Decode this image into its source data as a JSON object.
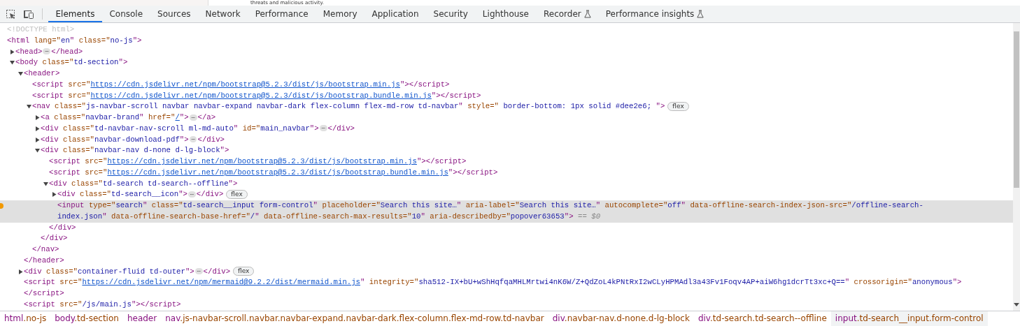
{
  "page_behind": {
    "text": "threats and malicious activity."
  },
  "toolbar": {
    "tabs": [
      {
        "label": "Elements",
        "selected": true,
        "experimental": false
      },
      {
        "label": "Console",
        "selected": false,
        "experimental": false
      },
      {
        "label": "Sources",
        "selected": false,
        "experimental": false
      },
      {
        "label": "Network",
        "selected": false,
        "experimental": false
      },
      {
        "label": "Performance",
        "selected": false,
        "experimental": false
      },
      {
        "label": "Memory",
        "selected": false,
        "experimental": false
      },
      {
        "label": "Application",
        "selected": false,
        "experimental": false
      },
      {
        "label": "Security",
        "selected": false,
        "experimental": false
      },
      {
        "label": "Lighthouse",
        "selected": false,
        "experimental": false
      },
      {
        "label": "Recorder",
        "selected": false,
        "experimental": true
      },
      {
        "label": "Performance insights",
        "selected": false,
        "experimental": true
      }
    ]
  },
  "dom_tree": [
    {
      "parts": [
        {
          "kind": "doctype",
          "text": "<!DOCTYPE html>"
        }
      ],
      "selected": false
    },
    {
      "parts": [
        {
          "kind": "tag",
          "text": "<html"
        },
        {
          "kind": "attr",
          "text": " lang=\""
        },
        {
          "kind": "value",
          "text": "en"
        },
        {
          "kind": "tag",
          "text": "\""
        },
        {
          "kind": "attr",
          "text": " class=\""
        },
        {
          "kind": "value",
          "text": "no-js"
        },
        {
          "kind": "tag",
          "text": "\">"
        }
      ],
      "selected": false,
      "children": [
        {
          "parts": [
            {
              "kind": "tag",
              "text": "<head>"
            },
            {
              "kind": "ellipsis",
              "text": "⋯"
            },
            {
              "kind": "tag",
              "text": "</head>"
            }
          ],
          "expanded": false,
          "selected": false
        },
        {
          "parts": [
            {
              "kind": "tag",
              "text": "<body"
            },
            {
              "kind": "attr",
              "text": " class=\""
            },
            {
              "kind": "value",
              "text": "td-section"
            },
            {
              "kind": "tag",
              "text": "\">"
            }
          ],
          "expanded": true,
          "selected": false,
          "children": [
            {
              "parts": [
                {
                  "kind": "tag",
                  "text": "<header>"
                }
              ],
              "expanded": true,
              "selected": false,
              "close": [
                {
                  "kind": "tag",
                  "text": "</header>"
                }
              ],
              "children": [
                {
                  "parts": [
                    {
                      "kind": "tag",
                      "text": "<script"
                    },
                    {
                      "kind": "attr",
                      "text": " src=\""
                    },
                    {
                      "kind": "link",
                      "text": "https://cdn.jsdelivr.net/npm/bootstrap@5.2.3/dist/js/bootstrap.min.js"
                    },
                    {
                      "kind": "tag",
                      "text": "\"></script>"
                    }
                  ],
                  "selected": false
                },
                {
                  "parts": [
                    {
                      "kind": "tag",
                      "text": "<script"
                    },
                    {
                      "kind": "attr",
                      "text": " src=\""
                    },
                    {
                      "kind": "link",
                      "text": "https://cdn.jsdelivr.net/npm/bootstrap@5.2.3/dist/js/bootstrap.bundle.min.js"
                    },
                    {
                      "kind": "tag",
                      "text": "\"></script>"
                    }
                  ],
                  "selected": false
                },
                {
                  "parts": [
                    {
                      "kind": "tag",
                      "text": "<nav"
                    },
                    {
                      "kind": "attr",
                      "text": " class=\""
                    },
                    {
                      "kind": "value",
                      "text": "js-navbar-scroll navbar navbar-expand navbar-dark flex-column flex-md-row td-navbar"
                    },
                    {
                      "kind": "tag",
                      "text": "\""
                    },
                    {
                      "kind": "attr",
                      "text": " style=\""
                    },
                    {
                      "kind": "value",
                      "text": " border-bottom: 1px solid #dee2e6; "
                    },
                    {
                      "kind": "tag",
                      "text": "\">"
                    },
                    {
                      "kind": "badge",
                      "text": "flex"
                    }
                  ],
                  "expanded": true,
                  "selected": false,
                  "close": [
                    {
                      "kind": "tag",
                      "text": "</nav>"
                    }
                  ],
                  "children": [
                    {
                      "parts": [
                        {
                          "kind": "tag",
                          "text": "<a"
                        },
                        {
                          "kind": "attr",
                          "text": " class=\""
                        },
                        {
                          "kind": "value",
                          "text": "navbar-brand"
                        },
                        {
                          "kind": "tag",
                          "text": "\""
                        },
                        {
                          "kind": "attr",
                          "text": " href=\""
                        },
                        {
                          "kind": "link",
                          "text": "/"
                        },
                        {
                          "kind": "tag",
                          "text": "\">"
                        },
                        {
                          "kind": "ellipsis",
                          "text": "⋯"
                        },
                        {
                          "kind": "tag",
                          "text": "</a>"
                        }
                      ],
                      "expanded": false,
                      "selected": false
                    },
                    {
                      "parts": [
                        {
                          "kind": "tag",
                          "text": "<div"
                        },
                        {
                          "kind": "attr",
                          "text": " class=\""
                        },
                        {
                          "kind": "value",
                          "text": "td-navbar-nav-scroll ml-md-auto"
                        },
                        {
                          "kind": "tag",
                          "text": "\""
                        },
                        {
                          "kind": "attr",
                          "text": " id=\""
                        },
                        {
                          "kind": "value",
                          "text": "main_navbar"
                        },
                        {
                          "kind": "tag",
                          "text": "\">"
                        },
                        {
                          "kind": "ellipsis",
                          "text": "⋯"
                        },
                        {
                          "kind": "tag",
                          "text": "</div>"
                        }
                      ],
                      "expanded": false,
                      "selected": false
                    },
                    {
                      "parts": [
                        {
                          "kind": "tag",
                          "text": "<div"
                        },
                        {
                          "kind": "attr",
                          "text": " class=\""
                        },
                        {
                          "kind": "value",
                          "text": "navbar-download-pdf"
                        },
                        {
                          "kind": "tag",
                          "text": "\">"
                        },
                        {
                          "kind": "ellipsis",
                          "text": "⋯"
                        },
                        {
                          "kind": "tag",
                          "text": "</div>"
                        }
                      ],
                      "expanded": false,
                      "selected": false
                    },
                    {
                      "parts": [
                        {
                          "kind": "tag",
                          "text": "<div"
                        },
                        {
                          "kind": "attr",
                          "text": " class=\""
                        },
                        {
                          "kind": "value",
                          "text": "navbar-nav d-none d-lg-block"
                        },
                        {
                          "kind": "tag",
                          "text": "\">"
                        }
                      ],
                      "expanded": true,
                      "selected": false,
                      "close": [
                        {
                          "kind": "tag",
                          "text": "</div>"
                        }
                      ],
                      "children": [
                        {
                          "parts": [
                            {
                              "kind": "tag",
                              "text": "<script"
                            },
                            {
                              "kind": "attr",
                              "text": " src=\""
                            },
                            {
                              "kind": "link",
                              "text": "https://cdn.jsdelivr.net/npm/bootstrap@5.2.3/dist/js/bootstrap.min.js"
                            },
                            {
                              "kind": "tag",
                              "text": "\"></script>"
                            }
                          ],
                          "selected": false
                        },
                        {
                          "parts": [
                            {
                              "kind": "tag",
                              "text": "<script"
                            },
                            {
                              "kind": "attr",
                              "text": " src=\""
                            },
                            {
                              "kind": "link",
                              "text": "https://cdn.jsdelivr.net/npm/bootstrap@5.2.3/dist/js/bootstrap.bundle.min.js"
                            },
                            {
                              "kind": "tag",
                              "text": "\"></script>"
                            }
                          ],
                          "selected": false
                        },
                        {
                          "parts": [
                            {
                              "kind": "tag",
                              "text": "<div"
                            },
                            {
                              "kind": "attr",
                              "text": " class=\""
                            },
                            {
                              "kind": "value",
                              "text": "td-search td-search--offline"
                            },
                            {
                              "kind": "tag",
                              "text": "\">"
                            }
                          ],
                          "expanded": true,
                          "selected": false,
                          "close": [
                            {
                              "kind": "tag",
                              "text": "</div>"
                            }
                          ],
                          "children": [
                            {
                              "parts": [
                                {
                                  "kind": "tag",
                                  "text": "<div"
                                },
                                {
                                  "kind": "attr",
                                  "text": " class=\""
                                },
                                {
                                  "kind": "value",
                                  "text": "td-search__icon"
                                },
                                {
                                  "kind": "tag",
                                  "text": "\">"
                                },
                                {
                                  "kind": "ellipsis",
                                  "text": "⋯"
                                },
                                {
                                  "kind": "tag",
                                  "text": "</div>"
                                },
                                {
                                  "kind": "badge",
                                  "text": "flex"
                                }
                              ],
                              "expanded": false,
                              "selected": false
                            },
                            {
                              "parts": [
                                {
                                  "kind": "tag",
                                  "text": "<input"
                                },
                                {
                                  "kind": "attr",
                                  "text": " type=\""
                                },
                                {
                                  "kind": "value",
                                  "text": "search"
                                },
                                {
                                  "kind": "tag",
                                  "text": "\""
                                },
                                {
                                  "kind": "attr",
                                  "text": " class=\""
                                },
                                {
                                  "kind": "value",
                                  "text": "td-search__input form-control"
                                },
                                {
                                  "kind": "tag",
                                  "text": "\""
                                },
                                {
                                  "kind": "attr",
                                  "text": " placeholder=\""
                                },
                                {
                                  "kind": "value",
                                  "text": "Search this site…"
                                },
                                {
                                  "kind": "tag",
                                  "text": "\""
                                },
                                {
                                  "kind": "attr",
                                  "text": " aria-label=\""
                                },
                                {
                                  "kind": "value",
                                  "text": "Search this site…"
                                },
                                {
                                  "kind": "tag",
                                  "text": "\""
                                },
                                {
                                  "kind": "attr",
                                  "text": " autocomplete=\""
                                },
                                {
                                  "kind": "value",
                                  "text": "off"
                                },
                                {
                                  "kind": "tag",
                                  "text": "\""
                                },
                                {
                                  "kind": "attr",
                                  "text": " data-offline-search-index-json-src=\""
                                },
                                {
                                  "kind": "value",
                                  "text": "/offline-search-index.json"
                                },
                                {
                                  "kind": "tag",
                                  "text": "\""
                                },
                                {
                                  "kind": "attr",
                                  "text": " data-offline-search-base-href=\""
                                },
                                {
                                  "kind": "value",
                                  "text": "/"
                                },
                                {
                                  "kind": "tag",
                                  "text": "\""
                                },
                                {
                                  "kind": "attr",
                                  "text": " data-offline-search-max-results=\""
                                },
                                {
                                  "kind": "value",
                                  "text": "10"
                                },
                                {
                                  "kind": "tag",
                                  "text": "\""
                                },
                                {
                                  "kind": "attr",
                                  "text": " aria-describedby=\""
                                },
                                {
                                  "kind": "value",
                                  "text": "popover63653"
                                },
                                {
                                  "kind": "tag",
                                  "text": "\">"
                                },
                                {
                                  "kind": "note",
                                  "text": " == $0"
                                }
                              ],
                              "selected": true
                            }
                          ]
                        }
                      ]
                    }
                  ]
                }
              ]
            },
            {
              "parts": [
                {
                  "kind": "tag",
                  "text": "<div"
                },
                {
                  "kind": "attr",
                  "text": " class=\""
                },
                {
                  "kind": "value",
                  "text": "container-fluid td-outer"
                },
                {
                  "kind": "tag",
                  "text": "\">"
                },
                {
                  "kind": "ellipsis",
                  "text": "⋯"
                },
                {
                  "kind": "tag",
                  "text": "</div>"
                },
                {
                  "kind": "badge",
                  "text": "flex"
                }
              ],
              "expanded": false,
              "selected": false
            },
            {
              "parts": [
                {
                  "kind": "tag",
                  "text": "<script"
                },
                {
                  "kind": "attr",
                  "text": " src=\""
                },
                {
                  "kind": "link",
                  "text": "https://cdn.jsdelivr.net/npm/mermaid@9.2.2/dist/mermaid.min.js"
                },
                {
                  "kind": "tag",
                  "text": "\""
                },
                {
                  "kind": "attr",
                  "text": " integrity=\""
                },
                {
                  "kind": "value",
                  "text": "sha512-IX+bU+wShHqfqaMHLMrtwi4nK6W/Z+QdZoL4kPNtRxI2wCLyHPMAdl3a43Fv1Foqv4AP+aiW6hg1dcrTt3xc+Q=="
                },
                {
                  "kind": "tag",
                  "text": "\""
                },
                {
                  "kind": "attr",
                  "text": " crossorigin=\""
                },
                {
                  "kind": "value",
                  "text": "anonymous"
                },
                {
                  "kind": "tag",
                  "text": "\">"
                }
              ],
              "selected": false,
              "close": [
                {
                  "kind": "tag",
                  "text": "</script>"
                }
              ]
            },
            {
              "parts": [
                {
                  "kind": "tag",
                  "text": "<script"
                },
                {
                  "kind": "attr",
                  "text": " src=\""
                },
                {
                  "kind": "value",
                  "text": "/js/main.js"
                },
                {
                  "kind": "tag",
                  "text": "\"></script>"
                }
              ],
              "selected": false
            }
          ]
        }
      ]
    }
  ],
  "breadcrumbs": [
    {
      "tag": "html",
      "classes": ".no-js",
      "selected": false
    },
    {
      "tag": "body",
      "classes": ".td-section",
      "selected": false
    },
    {
      "tag": "header",
      "selected": false
    },
    {
      "tag": "nav",
      "classes": ".js-navbar-scroll.navbar.navbar-expand.navbar-dark.flex-column.flex-md-row.td-navbar",
      "selected": false
    },
    {
      "tag": "div",
      "classes": ".navbar-nav.d-none.d-lg-block",
      "selected": false
    },
    {
      "tag": "div",
      "classes": ".td-search.td-search--offline",
      "selected": false
    },
    {
      "tag": "input",
      "classes": ".td-search__input.form-control",
      "selected": true
    }
  ]
}
